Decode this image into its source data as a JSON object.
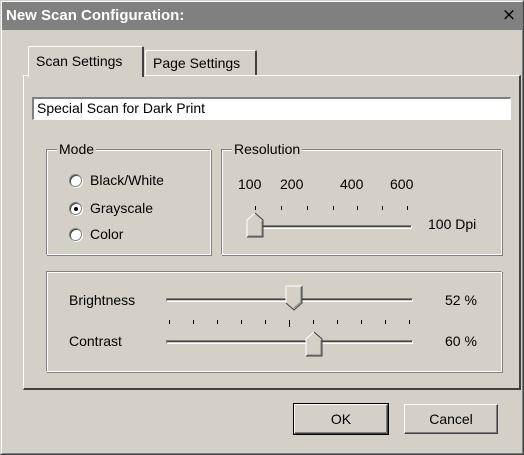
{
  "window": {
    "title": "New Scan Configuration:",
    "close_symbol": "×"
  },
  "tabs": [
    {
      "label": "Scan Settings",
      "active": true
    },
    {
      "label": "Page Settings",
      "active": false
    }
  ],
  "scan_name": {
    "value": "Special Scan for Dark Print"
  },
  "mode": {
    "label": "Mode",
    "options": [
      {
        "label": "Black/White",
        "selected": false
      },
      {
        "label": "Grayscale",
        "selected": true
      },
      {
        "label": "Color",
        "selected": false
      }
    ]
  },
  "resolution": {
    "label": "Resolution",
    "tick_labels": [
      "100",
      "200",
      "400",
      "600"
    ],
    "value_text": "100 Dpi",
    "slider_fraction": 0.0
  },
  "brightness": {
    "label": "Brightness",
    "value_text": "52 %",
    "percent": 52
  },
  "contrast": {
    "label": "Contrast",
    "value_text": "60 %",
    "percent": 60
  },
  "buttons": {
    "ok": "OK",
    "cancel": "Cancel"
  }
}
